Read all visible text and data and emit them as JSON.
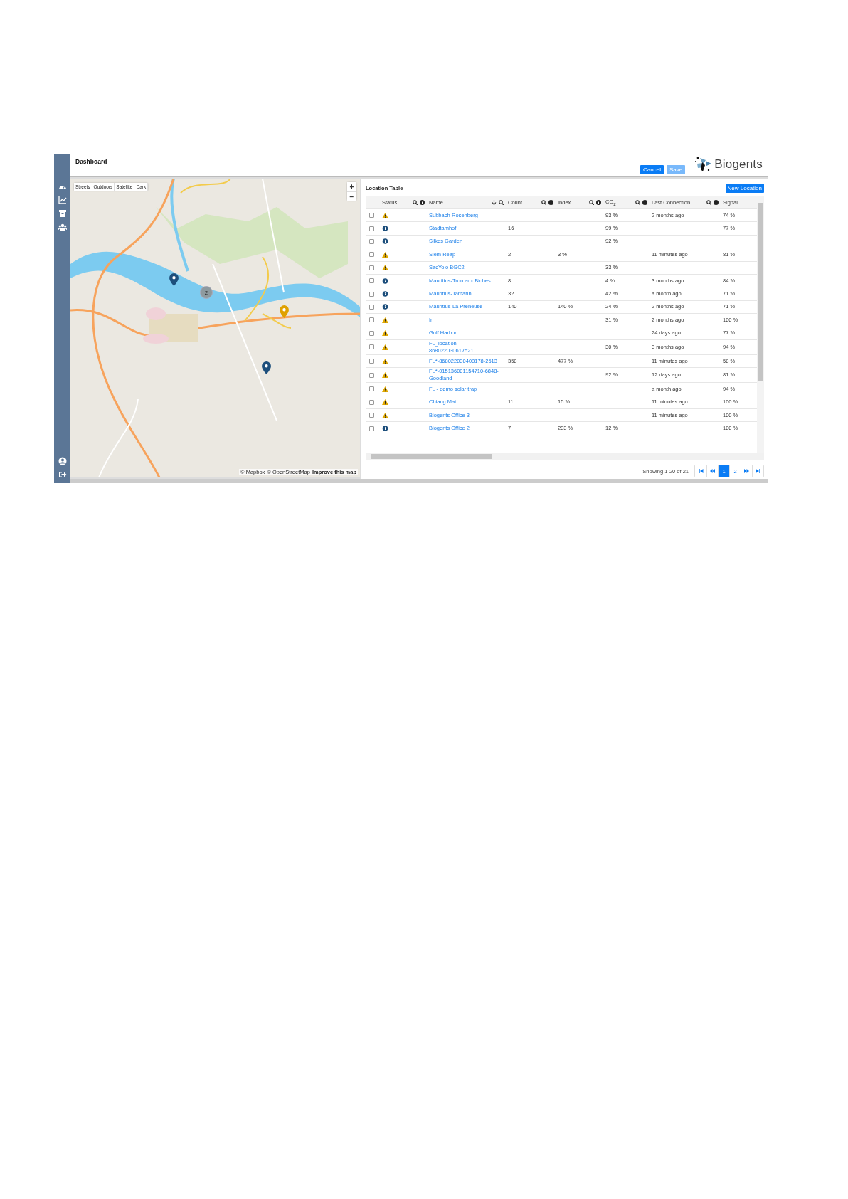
{
  "header": {
    "title": "Dashboard",
    "buttons": [
      {
        "label": "Cancel",
        "disabled": false
      },
      {
        "label": "Save",
        "disabled": true
      }
    ],
    "logo_text": "Biogents"
  },
  "map": {
    "layers": [
      "Streets",
      "Outdoors",
      "Satellite",
      "Dark"
    ],
    "zoom": [
      "+",
      "−"
    ],
    "markers": [
      {
        "kind": "pin",
        "color": "#1d4f7c"
      },
      {
        "kind": "cluster",
        "label": "2"
      },
      {
        "kind": "pin",
        "color": "#e0a100"
      },
      {
        "kind": "pin",
        "color": "#1d4f7c"
      }
    ],
    "attribution": [
      "© Mapbox",
      "© OpenStreetMap",
      "Improve this map"
    ]
  },
  "table": {
    "title": "Location Table",
    "new_button": "New Location",
    "columns": [
      {
        "label": "Status",
        "sorted": false,
        "info": true
      },
      {
        "label": "Name",
        "sorted": true,
        "info": false
      },
      {
        "label": "Count",
        "sorted": false,
        "info": true
      },
      {
        "label": "Index",
        "sorted": false,
        "info": true
      },
      {
        "label": "CO$_{2}$",
        "sorted": false,
        "info": true
      },
      {
        "label": "Last Connection",
        "sorted": false,
        "info": true
      },
      {
        "label": "Signal",
        "sorted": false,
        "info": false
      }
    ],
    "rows": [
      {
        "checked": false,
        "warning": true,
        "name": "Subbach-Rosenberg",
        "co2": "93 %",
        "last": "2 months ago",
        "signal": "74 %"
      },
      {
        "checked": false,
        "warning": false,
        "name": "Stadtamhof",
        "count": "16",
        "co2": "99 %",
        "signal": "77 %"
      },
      {
        "checked": false,
        "warning": false,
        "name": "Silkes Garden",
        "co2": "92 %"
      },
      {
        "checked": false,
        "warning": true,
        "name": "Siem Reap",
        "count": "2",
        "index": "3 %",
        "last": "11 minutes ago",
        "signal": "81 %"
      },
      {
        "checked": false,
        "warning": true,
        "name": "SacYolo BGC2",
        "co2": "33 %"
      },
      {
        "checked": false,
        "warning": false,
        "name": "Mauritius-Trou aux Biches",
        "count": "8",
        "co2": "4 %",
        "last": "3 months ago",
        "signal": "84 %"
      },
      {
        "checked": false,
        "warning": false,
        "name": "Mauritius-Tamarin",
        "count": "32",
        "co2": "42 %",
        "last": "a month ago",
        "signal": "71 %"
      },
      {
        "checked": false,
        "warning": false,
        "name": "Mauritius-La Preneuse",
        "count": "140",
        "index": "140 %",
        "co2": "24 %",
        "last": "2 months ago",
        "signal": "71 %"
      },
      {
        "checked": false,
        "warning": true,
        "name": "Irl",
        "co2": "31 %",
        "last": "2 months ago",
        "signal": "100 %"
      },
      {
        "checked": false,
        "warning": true,
        "name": "Gulf Harbor",
        "last": "24 days ago",
        "signal": "77 %"
      },
      {
        "checked": false,
        "warning": true,
        "name": "FL_location-868022030617521",
        "co2": "30 %",
        "last": "3 months ago",
        "signal": "94 %"
      },
      {
        "checked": false,
        "warning": true,
        "name": "FL*-868022030408178-2513",
        "count": "358",
        "index": "477 %",
        "last": "11 minutes ago",
        "signal": "58 %"
      },
      {
        "checked": false,
        "warning": true,
        "name": "FL*-015136001154710-6848-Goodland",
        "co2": "92 %",
        "last": "12 days ago",
        "signal": "81 %"
      },
      {
        "checked": false,
        "warning": true,
        "name": "FL - demo solar trap",
        "last": "a month ago",
        "signal": "94 %"
      },
      {
        "checked": false,
        "warning": true,
        "name": "Chiang Mai",
        "count": "11",
        "index": "15 %",
        "last": "11 minutes ago",
        "signal": "100 %"
      },
      {
        "checked": false,
        "warning": true,
        "name": "Biogents Office 3",
        "last": "11 minutes ago",
        "signal": "100 %"
      },
      {
        "checked": false,
        "warning": false,
        "name": "Biogents Office 2",
        "count": "7",
        "index": "233 %",
        "co2": "12 %",
        "signal": "100 %"
      }
    ],
    "pagination": {
      "summary": "Showing 1-20 of 21",
      "pages": [
        {
          "label": "1",
          "selected": true
        },
        {
          "label": "2",
          "selected": false
        }
      ]
    }
  }
}
